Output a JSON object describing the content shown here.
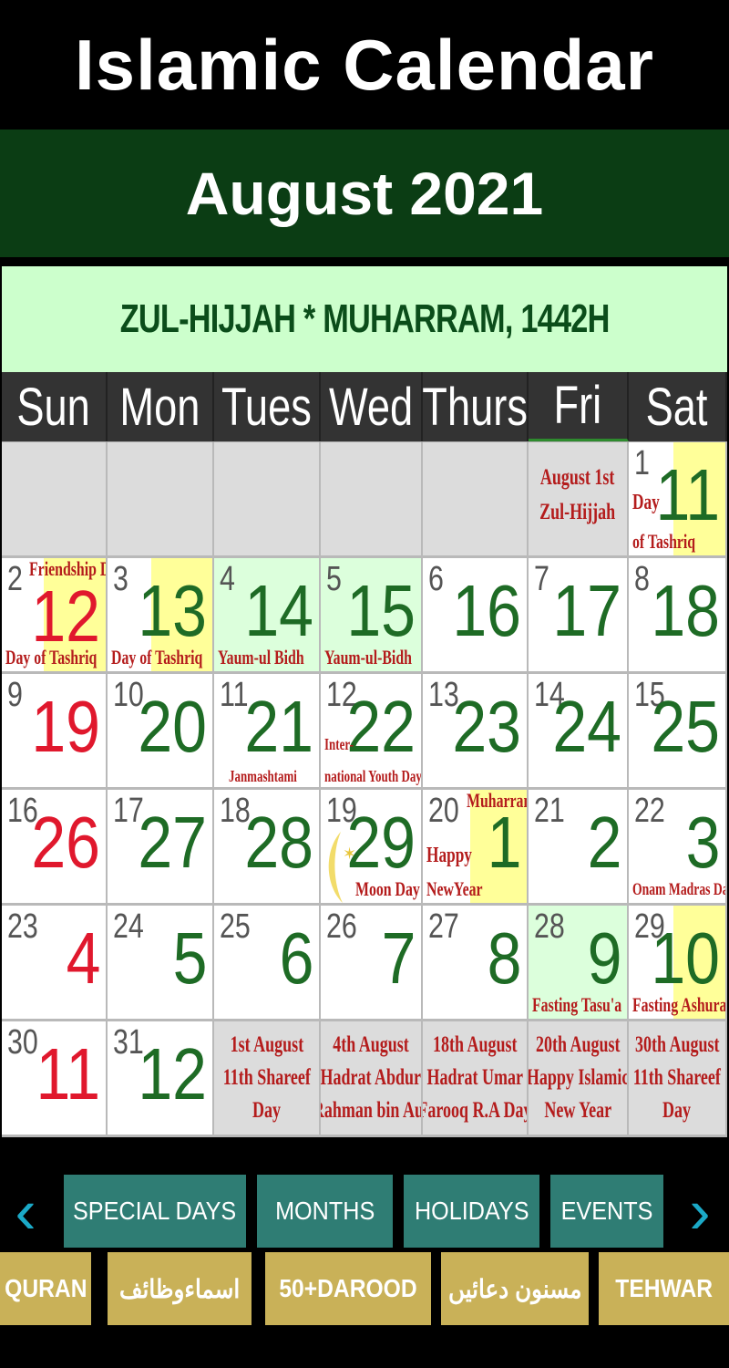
{
  "app": {
    "title": "Islamic Calendar"
  },
  "banner": {
    "month": "August 2021"
  },
  "calendar": {
    "hijri_title": "ZUL-HIJJAH * MUHARRAM, 1442H",
    "weekdays": [
      "Sun",
      "Mon",
      "Tues",
      "Wed",
      "Thurs",
      "Fri",
      "Sat"
    ],
    "colors": {
      "hijri_number": "#1e6b25",
      "sunday_number": "#e0182d",
      "note": "#b41c1c",
      "highlight": "#ffff99",
      "green_cell": "#dcffdc"
    },
    "weeks": [
      [
        {
          "bg": "gray"
        },
        {
          "bg": "gray"
        },
        {
          "bg": "gray"
        },
        {
          "bg": "gray"
        },
        {
          "bg": "gray"
        },
        {
          "bg": "gray",
          "event_lines": [
            "August 1st",
            "Zul-Hijjah"
          ]
        },
        {
          "greg": "1",
          "hijri": "11",
          "hl": true,
          "note_top": "",
          "note_mid": "Day",
          "note_bottom": "of Tashriq"
        }
      ],
      [
        {
          "greg": "2",
          "hijri": "12",
          "red": true,
          "hl": true,
          "note_top": "Friendship Day",
          "note_bottom": "Day of Tashriq"
        },
        {
          "greg": "3",
          "hijri": "13",
          "hl": true,
          "note_bottom": "Day of Tashriq"
        },
        {
          "greg": "4",
          "hijri": "14",
          "bg": "green",
          "note_bottom": "Yaum-ul Bidh"
        },
        {
          "greg": "5",
          "hijri": "15",
          "bg": "green",
          "note_bottom": "Yaum-ul-Bidh"
        },
        {
          "greg": "6",
          "hijri": "16"
        },
        {
          "greg": "7",
          "hijri": "17"
        },
        {
          "greg": "8",
          "hijri": "18"
        }
      ],
      [
        {
          "greg": "9",
          "hijri": "19",
          "red": true
        },
        {
          "greg": "10",
          "hijri": "20"
        },
        {
          "greg": "11",
          "hijri": "21",
          "note_bottom": "Janmashtami"
        },
        {
          "greg": "12",
          "hijri": "22",
          "note_mid": "Inter-",
          "note_bottom": "national Youth Day"
        },
        {
          "greg": "13",
          "hijri": "23"
        },
        {
          "greg": "14",
          "hijri": "24"
        },
        {
          "greg": "15",
          "hijri": "25"
        }
      ],
      [
        {
          "greg": "16",
          "hijri": "26",
          "red": true
        },
        {
          "greg": "17",
          "hijri": "27"
        },
        {
          "greg": "18",
          "hijri": "28"
        },
        {
          "greg": "19",
          "hijri": "29",
          "moon": true,
          "note_bottom": "Moon Day"
        },
        {
          "greg": "20",
          "hijri": "1",
          "hl": true,
          "note_top": "Muharram",
          "note_mid": "Happy",
          "note_bottom": "NewYear"
        },
        {
          "greg": "21",
          "hijri": "2"
        },
        {
          "greg": "22",
          "hijri": "3",
          "note_bottom": "Onam Madras Day"
        }
      ],
      [
        {
          "greg": "23",
          "hijri": "4",
          "red": true
        },
        {
          "greg": "24",
          "hijri": "5"
        },
        {
          "greg": "25",
          "hijri": "6"
        },
        {
          "greg": "26",
          "hijri": "7"
        },
        {
          "greg": "27",
          "hijri": "8"
        },
        {
          "greg": "28",
          "hijri": "9",
          "bg": "green",
          "note_bottom": "Fasting Tasu'a"
        },
        {
          "greg": "29",
          "hijri": "10",
          "hl": true,
          "note_bottom": "Fasting Ashura"
        }
      ],
      [
        {
          "greg": "30",
          "hijri": "11",
          "red": true
        },
        {
          "greg": "31",
          "hijri": "12"
        },
        {
          "bg": "gray",
          "event_lines": [
            "1st August",
            "11th Shareef",
            "Day"
          ]
        },
        {
          "bg": "gray",
          "event_lines": [
            "4th August",
            "Hadrat Abdur",
            "Rahman bin Auf"
          ]
        },
        {
          "bg": "gray",
          "event_lines": [
            "18th August",
            "Hadrat Umar",
            "Farooq R.A Day"
          ]
        },
        {
          "bg": "gray",
          "event_lines": [
            "20th August",
            "Happy Islamic",
            "New Year"
          ]
        },
        {
          "bg": "gray",
          "event_lines": [
            "30th August",
            "11th Shareef",
            "Day"
          ]
        }
      ]
    ]
  },
  "nav": {
    "prev_icon": "chevron-left-icon",
    "next_icon": "chevron-right-icon",
    "tabs": [
      "SPECIAL DAYS",
      "MONTHS",
      "HOLIDAYS",
      "EVENTS"
    ]
  },
  "bottom_menu": {
    "items": [
      "QURAN",
      "اسماءوظائف",
      "50+DAROOD",
      "مسنون دعائیں",
      "TEHWAR"
    ]
  }
}
